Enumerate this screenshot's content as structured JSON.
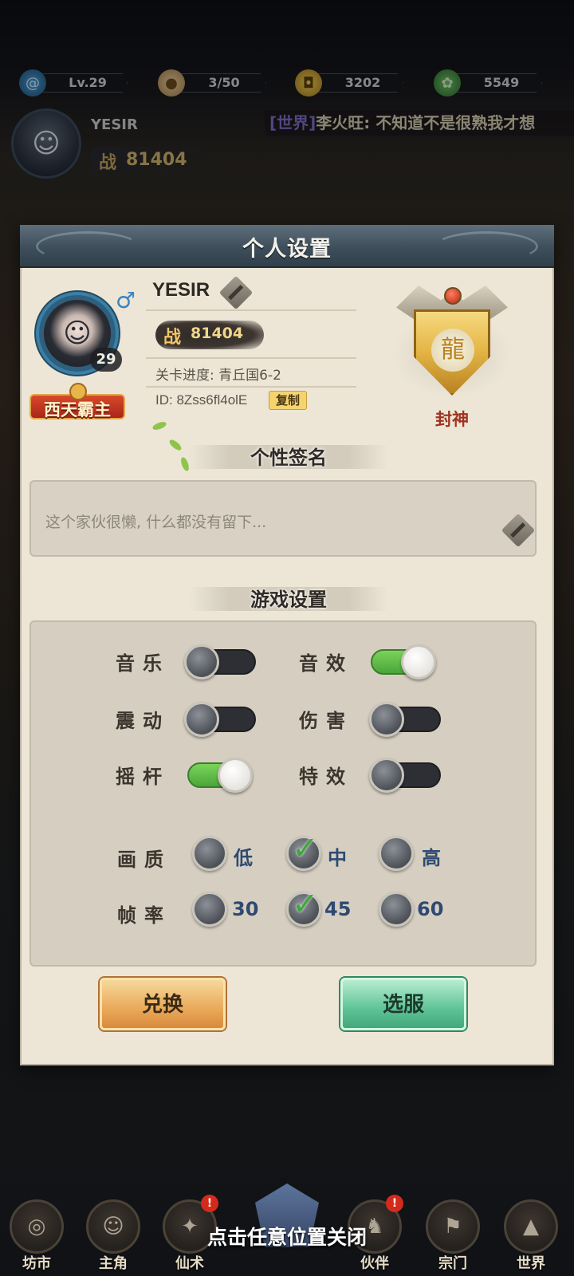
{
  "hud": {
    "level": "Lv.29",
    "stamina": "3/50",
    "coins": "3202",
    "leaves": "5549",
    "player_name": "YESIR",
    "power_label": "战",
    "power_value": "81404",
    "world_chat_tag": "[世界]",
    "world_chat_msg": "李火旺: 不知道不是很熟我才想"
  },
  "dialog": {
    "title": "个人设置",
    "profile": {
      "name": "YESIR",
      "level": "29",
      "gender_symbol": "♂",
      "title_badge": "西天霸主",
      "power_label": "战",
      "power_value": "81404",
      "progress": "关卡进度: 青丘国6-2",
      "id": "ID: 8Zss6fl4olE",
      "copy_label": "复制",
      "rank_label": "封神"
    },
    "signature_heading": "个性签名",
    "signature_text": "这个家伙很懒, 什么都没有留下...",
    "settings_heading": "游戏设置",
    "toggles": {
      "music": {
        "label": "音乐",
        "on": false
      },
      "sfx": {
        "label": "音效",
        "on": true
      },
      "vibration": {
        "label": "震动",
        "on": false
      },
      "damage": {
        "label": "伤害",
        "on": false
      },
      "joystick": {
        "label": "摇杆",
        "on": true
      },
      "effects": {
        "label": "特效",
        "on": false
      }
    },
    "quality": {
      "label": "画质",
      "options": [
        "低",
        "中",
        "高"
      ],
      "selected": "中"
    },
    "framerate": {
      "label": "帧率",
      "options": [
        "30",
        "45",
        "60"
      ],
      "selected": "45"
    },
    "exchange_button": "兑换",
    "server_button": "选服"
  },
  "bottom_nav": {
    "items": [
      "坊市",
      "主角",
      "仙术",
      "伙伴",
      "宗门",
      "世界"
    ],
    "close_hint": "点击任意位置关闭"
  },
  "colors": {
    "toggle_on": "#5fbf48",
    "toggle_off": "#2d2f34",
    "check": "#3fa83a",
    "dialog_bg": "#ede6d6"
  }
}
